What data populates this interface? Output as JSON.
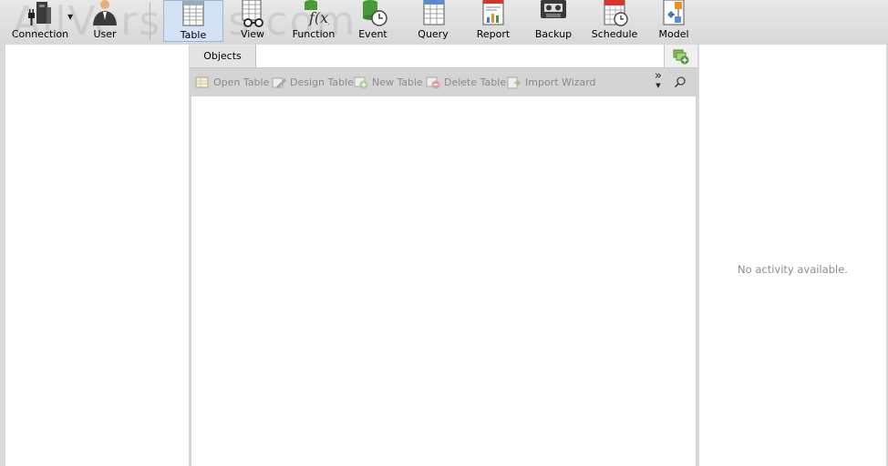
{
  "toolbar": {
    "watermark": "AllVersions.com",
    "buttons": [
      {
        "label": "Connection",
        "icon": "connection-icon"
      },
      {
        "label": "User",
        "icon": "user-icon"
      },
      {
        "label": "Table",
        "icon": "table-icon",
        "selected": true
      },
      {
        "label": "View",
        "icon": "view-icon"
      },
      {
        "label": "Function",
        "icon": "function-icon"
      },
      {
        "label": "Event",
        "icon": "event-icon"
      },
      {
        "label": "Query",
        "icon": "query-icon"
      },
      {
        "label": "Report",
        "icon": "report-icon"
      },
      {
        "label": "Backup",
        "icon": "backup-icon"
      },
      {
        "label": "Schedule",
        "icon": "schedule-icon"
      },
      {
        "label": "Model",
        "icon": "model-icon"
      }
    ]
  },
  "objects_tab": {
    "label": "Objects",
    "actions": [
      {
        "label": "Open Table",
        "icon": "open-table-icon"
      },
      {
        "label": "Design Table",
        "icon": "design-table-icon"
      },
      {
        "label": "New Table",
        "icon": "new-table-icon"
      },
      {
        "label": "Delete Table",
        "icon": "delete-table-icon"
      },
      {
        "label": "Import Wizard",
        "icon": "import-wizard-icon"
      }
    ],
    "more_symbol": "»",
    "items": []
  },
  "activity": {
    "empty_text": "No activity available."
  },
  "colors": {
    "selected_bg": "#d3e2f5",
    "disabled_text": "#8a8a8a",
    "function_green": "#4a9a3a",
    "schedule_red": "#d9342b",
    "model_orange": "#e8902a"
  }
}
